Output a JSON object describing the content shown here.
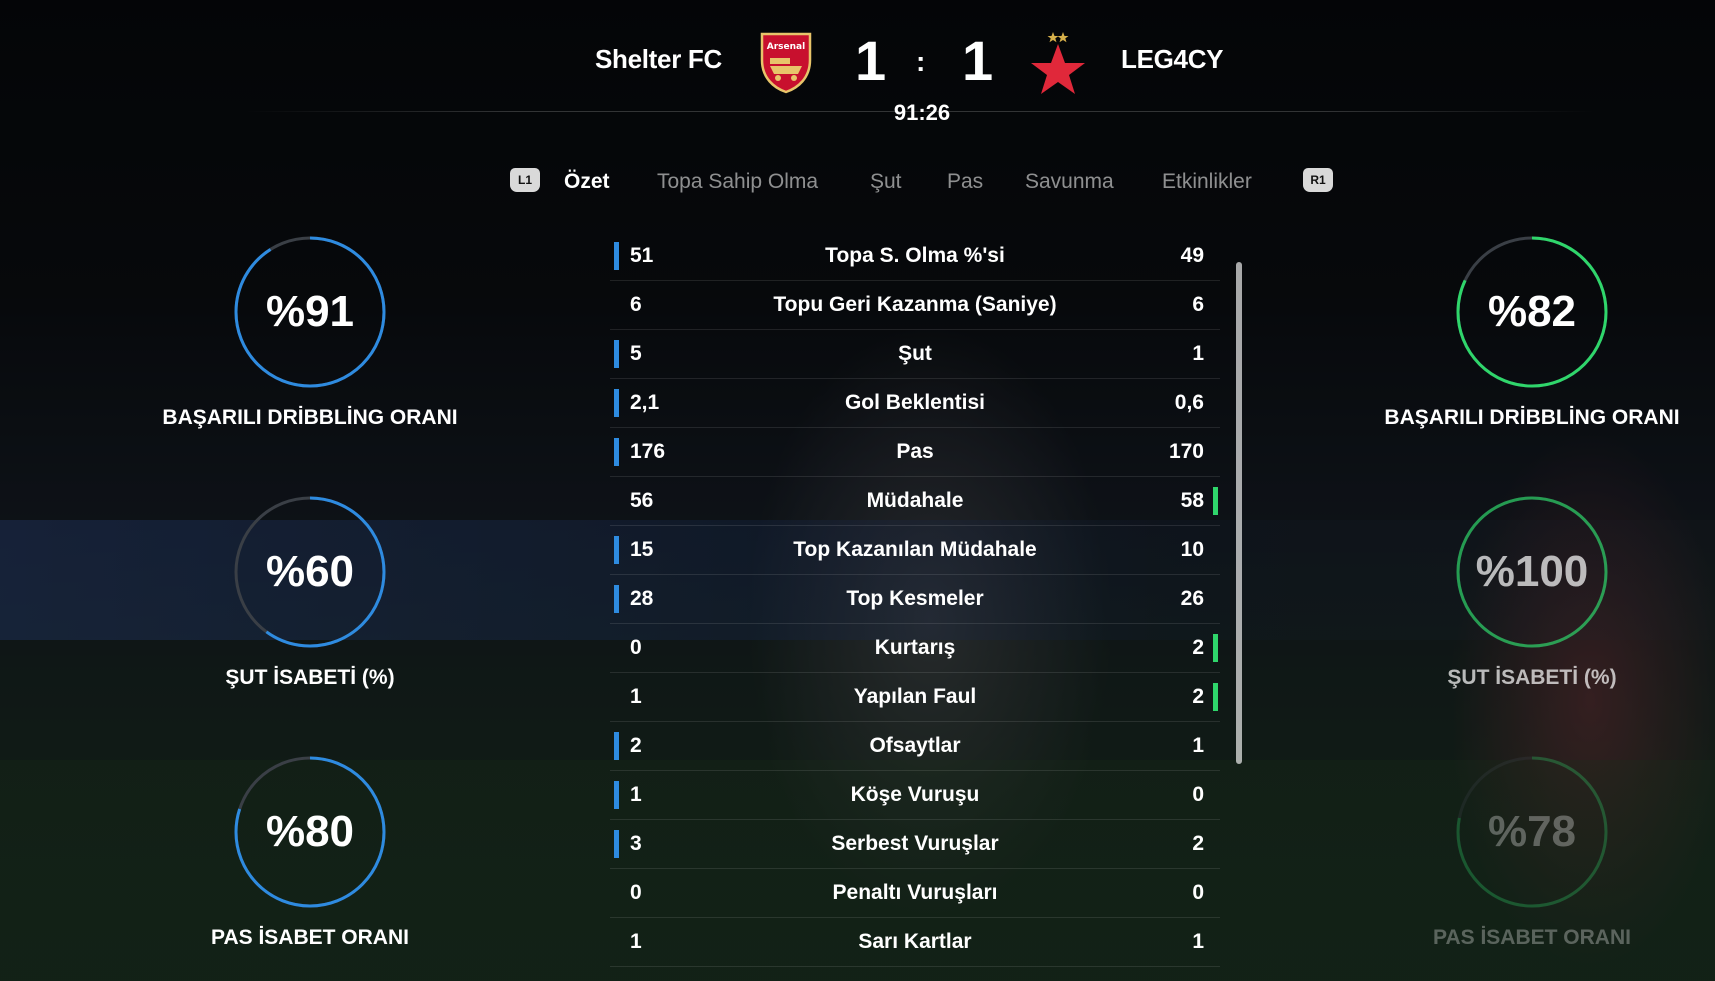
{
  "match": {
    "home_team": "Shelter FC",
    "home_crest_text": "Arsenal",
    "home_score": "1",
    "separator": ":",
    "away_score": "1",
    "away_team": "LEG4CY",
    "clock": "91:26"
  },
  "tabs": {
    "left_bumper": "L1",
    "right_bumper": "R1",
    "items": [
      "Özet",
      "Topa Sahip Olma",
      "Şut",
      "Pas",
      "Savunma",
      "Etkinlikler"
    ],
    "active": "Özet"
  },
  "home_rings": [
    {
      "value": "%91",
      "percent": 91,
      "label": "BAŞARILI DRİBBLİNG ORANI"
    },
    {
      "value": "%60",
      "percent": 60,
      "label": "ŞUT İSABETİ (%)"
    },
    {
      "value": "%80",
      "percent": 80,
      "label": "PAS İSABET ORANI"
    }
  ],
  "away_rings": [
    {
      "value": "%82",
      "percent": 82,
      "label": "BAŞARILI DRİBBLİNG ORANI"
    },
    {
      "value": "%100",
      "percent": 100,
      "label": "ŞUT İSABETİ (%)"
    },
    {
      "value": "%78",
      "percent": 78,
      "label": "PAS İSABET ORANI"
    }
  ],
  "stats": [
    {
      "home": "51",
      "name": "Topa S. Olma %'si",
      "away": "49",
      "leader": "home"
    },
    {
      "home": "6",
      "name": "Topu Geri Kazanma (Saniye)",
      "away": "6",
      "leader": "none"
    },
    {
      "home": "5",
      "name": "Şut",
      "away": "1",
      "leader": "home"
    },
    {
      "home": "2,1",
      "name": "Gol Beklentisi",
      "away": "0,6",
      "leader": "home"
    },
    {
      "home": "176",
      "name": "Pas",
      "away": "170",
      "leader": "home"
    },
    {
      "home": "56",
      "name": "Müdahale",
      "away": "58",
      "leader": "away"
    },
    {
      "home": "15",
      "name": "Top Kazanılan Müdahale",
      "away": "10",
      "leader": "home"
    },
    {
      "home": "28",
      "name": "Top Kesmeler",
      "away": "26",
      "leader": "home"
    },
    {
      "home": "0",
      "name": "Kurtarış",
      "away": "2",
      "leader": "away"
    },
    {
      "home": "1",
      "name": "Yapılan Faul",
      "away": "2",
      "leader": "away"
    },
    {
      "home": "2",
      "name": "Ofsaytlar",
      "away": "1",
      "leader": "home"
    },
    {
      "home": "1",
      "name": "Köşe Vuruşu",
      "away": "0",
      "leader": "home"
    },
    {
      "home": "3",
      "name": "Serbest Vuruşlar",
      "away": "2",
      "leader": "home"
    },
    {
      "home": "0",
      "name": "Penaltı Vuruşları",
      "away": "0",
      "leader": "none"
    },
    {
      "home": "1",
      "name": "Sarı Kartlar",
      "away": "1",
      "leader": "none"
    }
  ],
  "colors": {
    "home_accent": "#2e8be0",
    "away_accent": "#2fd66b",
    "ring_track": "#3a3f46"
  }
}
